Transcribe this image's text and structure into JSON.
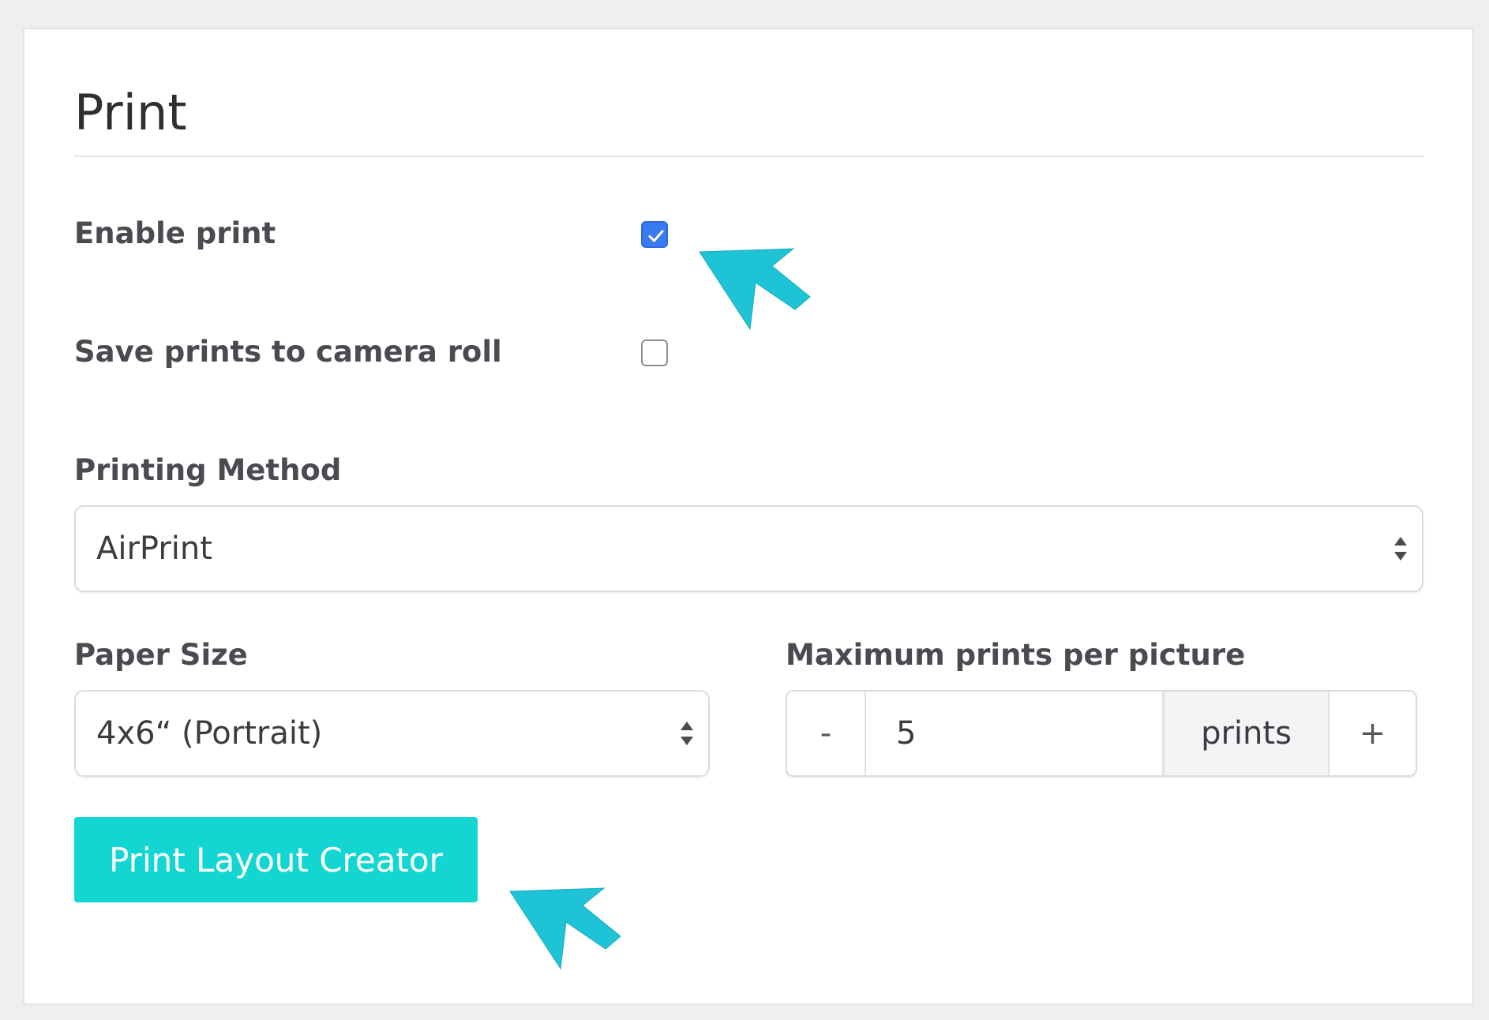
{
  "section": {
    "title": "Print"
  },
  "enable_print": {
    "label": "Enable print",
    "checked": true
  },
  "save_to_camera_roll": {
    "label": "Save prints to camera roll",
    "checked": false
  },
  "printing_method": {
    "label": "Printing Method",
    "selected": "AirPrint"
  },
  "paper_size": {
    "label": "Paper Size",
    "selected": "4x6“ (Portrait)"
  },
  "max_prints": {
    "label": "Maximum prints per picture",
    "decrement_label": "-",
    "value": "5",
    "unit": "prints",
    "increment_label": "+"
  },
  "layout_button": {
    "label": "Print Layout Creator"
  },
  "colors": {
    "accent_button": "#13d6d2",
    "checkbox_checked": "#3a7bf0",
    "callout_arrow": "#1fc3d6"
  },
  "icons": {
    "select_arrows": "up-down-arrows-icon",
    "checkmark": "checkmark-icon",
    "callout": "pointer-arrow-icon"
  }
}
